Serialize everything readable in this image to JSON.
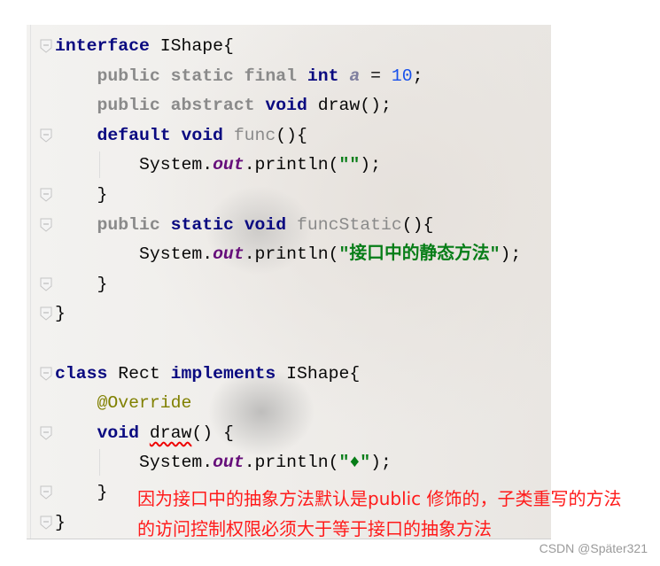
{
  "code": {
    "lines": [
      [
        {
          "t": "interface",
          "c": "kw"
        },
        {
          "t": " IShape{"
        }
      ],
      [
        {
          "t": "    "
        },
        {
          "t": "public static final",
          "c": "gray"
        },
        {
          "t": " "
        },
        {
          "t": "int",
          "c": "kw"
        },
        {
          "t": " "
        },
        {
          "t": "a",
          "c": "ital"
        },
        {
          "t": " = "
        },
        {
          "t": "10",
          "c": "num"
        },
        {
          "t": ";"
        }
      ],
      [
        {
          "t": "    "
        },
        {
          "t": "public abstract",
          "c": "gray"
        },
        {
          "t": " "
        },
        {
          "t": "void",
          "c": "kw"
        },
        {
          "t": " draw();"
        }
      ],
      [
        {
          "t": "    "
        },
        {
          "t": "default void",
          "c": "kw"
        },
        {
          "t": " "
        },
        {
          "t": "func",
          "c": "fn"
        },
        {
          "t": "(){"
        }
      ],
      [
        {
          "t": "        System."
        },
        {
          "t": "out",
          "c": "field"
        },
        {
          "t": ".println("
        },
        {
          "t": "\"\"",
          "c": "str"
        },
        {
          "t": ");"
        }
      ],
      [
        {
          "t": "    }"
        }
      ],
      [
        {
          "t": "    "
        },
        {
          "t": "public",
          "c": "gray"
        },
        {
          "t": " "
        },
        {
          "t": "static void",
          "c": "kw"
        },
        {
          "t": " "
        },
        {
          "t": "funcStatic",
          "c": "fn"
        },
        {
          "t": "(){"
        }
      ],
      [
        {
          "t": "        System."
        },
        {
          "t": "out",
          "c": "field"
        },
        {
          "t": ".println("
        },
        {
          "t": "\"接口中的静态方法\"",
          "c": "str"
        },
        {
          "t": ");"
        }
      ],
      [
        {
          "t": "    }"
        }
      ],
      [
        {
          "t": "}"
        }
      ],
      [],
      [
        {
          "t": "class",
          "c": "kw"
        },
        {
          "t": " Rect "
        },
        {
          "t": "implements",
          "c": "kw"
        },
        {
          "t": " IShape{"
        }
      ],
      [
        {
          "t": "    "
        },
        {
          "t": "@Override",
          "c": "ann"
        }
      ],
      [
        {
          "t": "    "
        },
        {
          "t": "void",
          "c": "kw"
        },
        {
          "t": " "
        },
        {
          "t": "draw",
          "c": "err"
        },
        {
          "t": "() {"
        }
      ],
      [
        {
          "t": "        System."
        },
        {
          "t": "out",
          "c": "field"
        },
        {
          "t": ".println("
        },
        {
          "t": "\"♦\"",
          "c": "str"
        },
        {
          "t": ");"
        }
      ],
      [
        {
          "t": "    }"
        }
      ],
      [
        {
          "t": "}"
        }
      ]
    ],
    "fold_lines": [
      0,
      3,
      5,
      6,
      8,
      9,
      11,
      13,
      15,
      16
    ]
  },
  "annotation": {
    "line1": "因为接口中的抽象方法默认是public 修饰的，子类重写的方法",
    "line2": "的访问控制权限必须大于等于接口的抽象方法",
    "color": "#ff1a1a"
  },
  "watermark": "CSDN @Später321"
}
